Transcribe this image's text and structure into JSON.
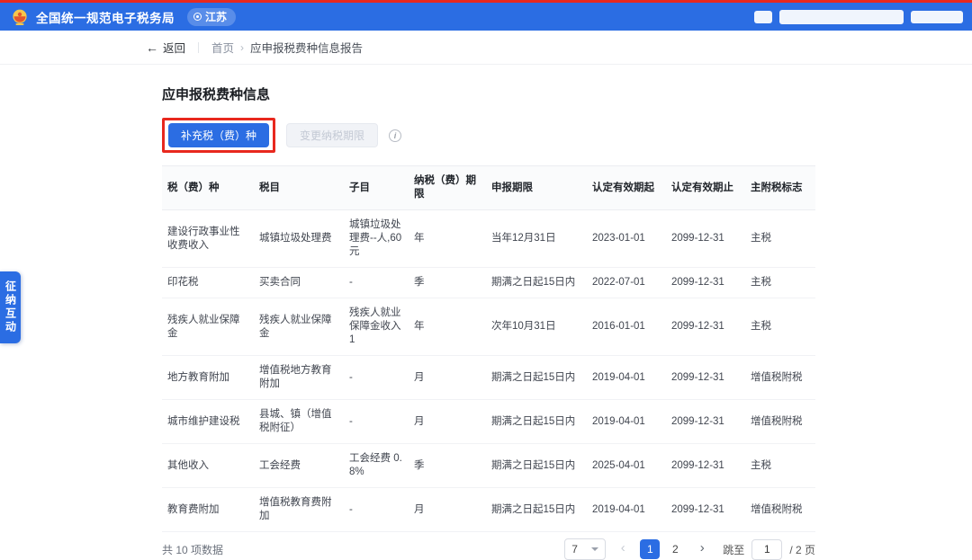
{
  "colors": {
    "primary": "#2B6DE3",
    "annotation_red": "#E8281E"
  },
  "icons": {
    "back_arrow": "←",
    "breadcrumb_sep": "›",
    "info": "i",
    "prev": "‹",
    "next": "›"
  },
  "header": {
    "title": "全国统一规范电子税务局",
    "region": "江苏"
  },
  "breadcrumb": {
    "back_label": "返回",
    "home": "首页",
    "current": "应申报税费种信息报告"
  },
  "main": {
    "title": "应申报税费种信息",
    "buttons": {
      "supplement": "补充税（费）种",
      "change_deadline": "变更纳税期限"
    },
    "table": {
      "headers": [
        "税（费）种",
        "税目",
        "子目",
        "纳税（费）期限",
        "申报期限",
        "认定有效期起",
        "认定有效期止",
        "主附税标志"
      ],
      "rows": [
        [
          "建设行政事业性收费收入",
          "城镇垃圾处理费",
          "城镇垃圾处理费--人,60元",
          "年",
          "当年12月31日",
          "2023-01-01",
          "2099-12-31",
          "主税"
        ],
        [
          "印花税",
          "买卖合同",
          "-",
          "季",
          "期满之日起15日内",
          "2022-07-01",
          "2099-12-31",
          "主税"
        ],
        [
          "残疾人就业保障金",
          "残疾人就业保障金",
          "残疾人就业保障金收入1",
          "年",
          "次年10月31日",
          "2016-01-01",
          "2099-12-31",
          "主税"
        ],
        [
          "地方教育附加",
          "增值税地方教育附加",
          "-",
          "月",
          "期满之日起15日内",
          "2019-04-01",
          "2099-12-31",
          "增值税附税"
        ],
        [
          "城市维护建设税",
          "县城、镇（增值税附征）",
          "-",
          "月",
          "期满之日起15日内",
          "2019-04-01",
          "2099-12-31",
          "增值税附税"
        ],
        [
          "其他收入",
          "工会经费",
          "工会经费 0.8%",
          "季",
          "期满之日起15日内",
          "2025-04-01",
          "2099-12-31",
          "主税"
        ],
        [
          "教育费附加",
          "增值税教育费附加",
          "-",
          "月",
          "期满之日起15日内",
          "2019-04-01",
          "2099-12-31",
          "增值税附税"
        ]
      ]
    },
    "pagination": {
      "total_text": "共 10 项数据",
      "page_size": "7",
      "pages": [
        "1",
        "2"
      ],
      "active_page": "1",
      "jump_label": "跳至",
      "jump_value": "1",
      "page_suffix": "/ 2 页"
    }
  },
  "side_tab": {
    "label": "征纳互动"
  }
}
